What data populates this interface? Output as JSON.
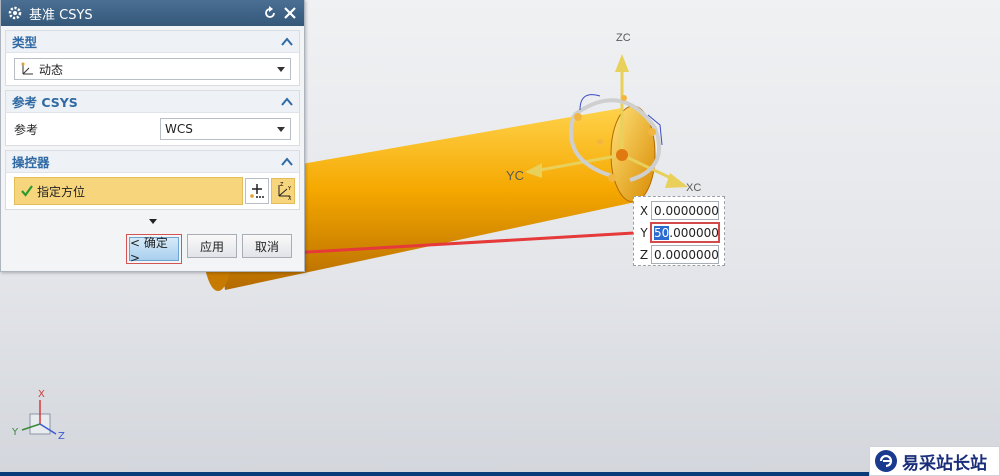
{
  "dialog": {
    "title": "基准 CSYS",
    "sections": {
      "type": {
        "title": "类型",
        "value": "动态"
      },
      "reference": {
        "title": "参考 CSYS",
        "label": "参考",
        "value": "WCS"
      },
      "manipulator": {
        "title": "操控器",
        "item_label": "指定方位"
      }
    },
    "buttons": {
      "ok": "< 确定 >",
      "apply": "应用",
      "cancel": "取消"
    }
  },
  "coord_popup": {
    "x_label": "X",
    "x_value": "0.0000000",
    "y_label": "Y",
    "y_value_selected": "50",
    "y_value_rest": ".000000",
    "z_label": "Z",
    "z_value": "0.0000000"
  },
  "axes": {
    "xc": "XC",
    "yc": "YC",
    "zc": "ZC"
  },
  "triad": {
    "x": "X",
    "y": "Y",
    "z": "Z"
  },
  "watermark": {
    "text": "易采站长站"
  },
  "colors": {
    "title_bar": "#35587a",
    "section_title": "#2f6aa4",
    "cylinder": "#f5a800",
    "highlight": "#f6d57d"
  }
}
